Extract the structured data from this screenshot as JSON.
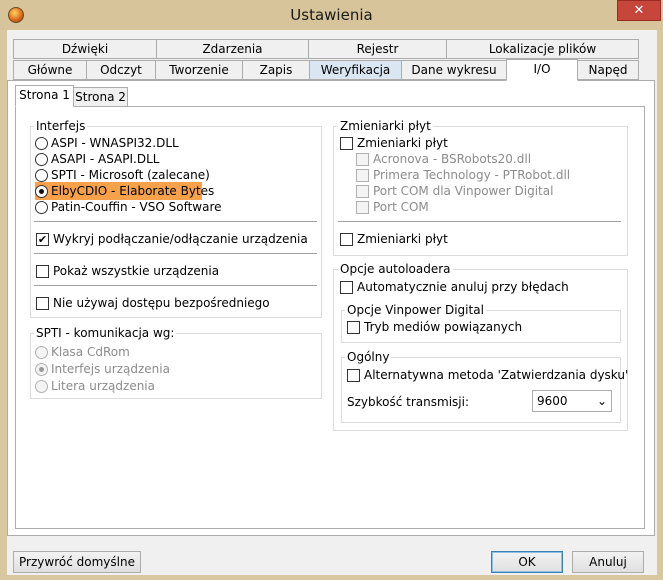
{
  "window": {
    "title": "Ustawienia",
    "close_symbol": "✕"
  },
  "tabs_row1": [
    "Dźwięki",
    "Zdarzenia",
    "Rejestr",
    "Lokalizacje plików"
  ],
  "tabs_row2": [
    "Główne",
    "Odczyt",
    "Tworzenie",
    "Zapis",
    "Weryfikacja",
    "Dane wykresu",
    "I/O",
    "Napęd"
  ],
  "subtabs": [
    "Strona 1",
    "Strona 2"
  ],
  "interfejs": {
    "label": "Interfejs",
    "options": [
      "ASPI - WNASPI32.DLL",
      "ASAPI - ASAPI.DLL",
      "SPTI - Microsoft (zalecane)",
      "ElbyCDIO - Elaborate Bytes",
      "Patin-Couffin - VSO Software"
    ],
    "selected_index": 3
  },
  "checks_left": [
    {
      "label": "Wykryj podłączanie/odłączanie urządzenia",
      "checked": true
    },
    {
      "label": "Pokaż wszystkie urządzenia",
      "checked": false
    },
    {
      "label": "Nie używaj dostępu bezpośredniego",
      "checked": false
    }
  ],
  "spti": {
    "label": "SPTI - komunikacja wg:",
    "options": [
      "Klasa CdRom",
      "Interfejs urządzenia",
      "Litera urządzenia"
    ],
    "selected_index": 1
  },
  "changers": {
    "label": "Zmieniarki płyt",
    "main_check": "Zmieniarki płyt",
    "items": [
      "Acronova - BSRobots20.dll",
      "Primera Technology - PTRobot.dll",
      "Port COM dla Vinpower Digital",
      "Port COM"
    ],
    "bottom_check": "Zmieniarki płyt"
  },
  "autoloader": {
    "label": "Opcje autoloadera",
    "auto_cancel": "Automatycznie anuluj przy błędach",
    "vinpower_label": "Opcje Vinpower Digital",
    "linked_media": "Tryb mediów powiązanych"
  },
  "general": {
    "label": "Ogólny",
    "alt_method": "Alternatywna metoda 'Zatwierdzania dysku'",
    "speed_label": "Szybkość transmisji:",
    "speed_value": "9600"
  },
  "buttons": {
    "restore": "Przywróć domyślne",
    "ok": "OK",
    "cancel": "Anuluj"
  }
}
